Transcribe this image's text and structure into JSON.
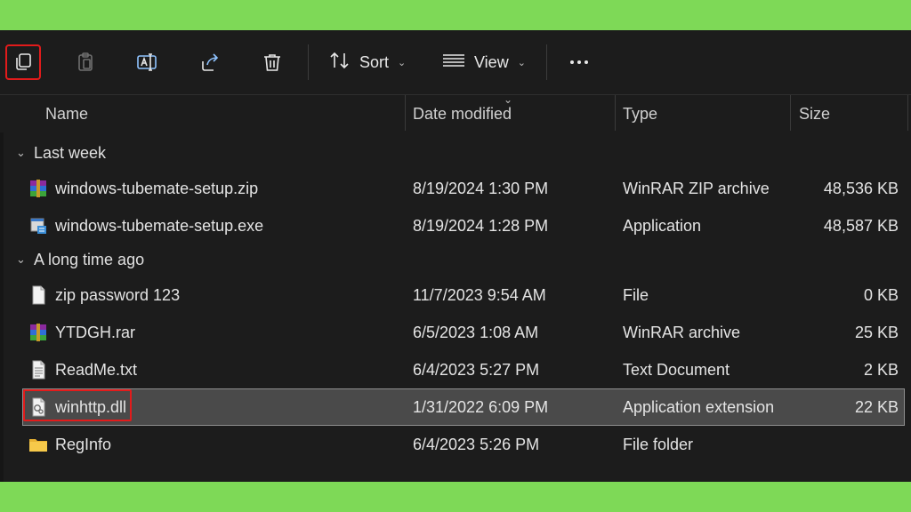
{
  "toolbar": {
    "copy_icon": "copy-icon",
    "paste_icon": "paste-icon",
    "rename_icon": "rename-icon",
    "share_icon": "share-icon",
    "delete_icon": "trash-icon",
    "sort_label": "Sort",
    "view_label": "View",
    "more_icon": "more-icon"
  },
  "columns": {
    "name": "Name",
    "date_modified": "Date modified",
    "type": "Type",
    "size": "Size"
  },
  "groups": [
    {
      "label": "Last week",
      "files": [
        {
          "name": "windows-tubemate-setup.zip",
          "date": "8/19/2024 1:30 PM",
          "type": "WinRAR ZIP archive",
          "size": "48,536 KB",
          "icon": "winrar-archive-icon"
        },
        {
          "name": "windows-tubemate-setup.exe",
          "date": "8/19/2024 1:28 PM",
          "type": "Application",
          "size": "48,587 KB",
          "icon": "setup-exe-icon"
        }
      ]
    },
    {
      "label": "A long time ago",
      "files": [
        {
          "name": "zip password 123",
          "date": "11/7/2023 9:54 AM",
          "type": "File",
          "size": "0 KB",
          "icon": "blank-file-icon"
        },
        {
          "name": "YTDGH.rar",
          "date": "6/5/2023 1:08 AM",
          "type": "WinRAR archive",
          "size": "25 KB",
          "icon": "winrar-archive-icon"
        },
        {
          "name": "ReadMe.txt",
          "date": "6/4/2023 5:27 PM",
          "type": "Text Document",
          "size": "2 KB",
          "icon": "text-file-icon"
        },
        {
          "name": "winhttp.dll",
          "date": "1/31/2022 6:09 PM",
          "type": "Application extension",
          "size": "22 KB",
          "icon": "dll-file-icon",
          "selected": true
        },
        {
          "name": "RegInfo",
          "date": "6/4/2023 5:26 PM",
          "type": "File folder",
          "size": "",
          "icon": "folder-icon"
        }
      ]
    }
  ],
  "colors": {
    "frame_green": "#7ed957",
    "background": "#1c1c1c",
    "highlight_red": "#e21b1b",
    "selected_row": "#4a4a4a"
  }
}
